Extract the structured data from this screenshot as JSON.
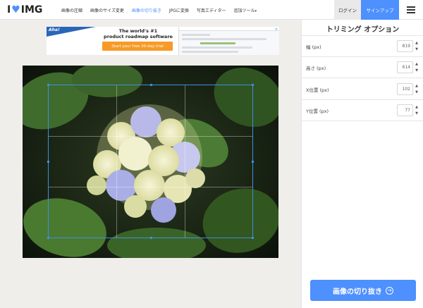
{
  "header": {
    "logo": {
      "left": "I",
      "right": "IMG",
      "heart_icon": "heart-icon"
    },
    "nav": [
      {
        "label": "画像の圧縮",
        "active": false
      },
      {
        "label": "画像のサイズ変更",
        "active": false
      },
      {
        "label": "画像の切り抜き",
        "active": true
      },
      {
        "label": "JPGに変換",
        "active": false
      },
      {
        "label": "写真エディター",
        "active": false
      },
      {
        "label": "追加ツール",
        "active": false,
        "caret": "▾"
      }
    ],
    "login": "ログイン",
    "signup": "サインアップ",
    "menu_icon": "hamburger-icon",
    "accent": "#4d90fe"
  },
  "ad": {
    "brand": "Aha!",
    "line1": "The world's #1",
    "line2": "product roadmap software",
    "cta": "Start your free 30-day trial",
    "close_icon": "ad-close-icon",
    "cta_color": "#f79a27"
  },
  "panel": {
    "title": "トリミング オプション",
    "fields": [
      {
        "label": "幅 (px)",
        "value": "819"
      },
      {
        "label": "高さ (px)",
        "value": "614"
      },
      {
        "label": "X位置 (px)",
        "value": "102"
      },
      {
        "label": "Y位置 (px)",
        "value": "77"
      }
    ],
    "crop_button": "画像の切り抜き",
    "crop_button_icon": "arrow-right-circle-icon"
  },
  "image": {
    "subject": "flower-photo"
  }
}
